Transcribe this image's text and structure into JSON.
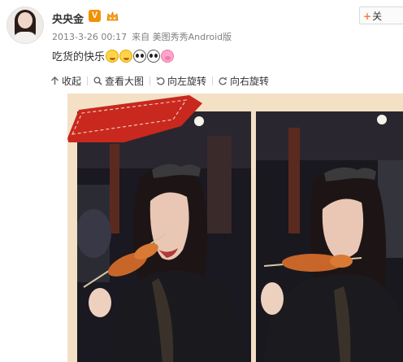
{
  "user": {
    "name": "央央金",
    "verified_badge": "V",
    "avatar_icon": "user-avatar"
  },
  "follow": {
    "label": "关"
  },
  "meta": {
    "time": "2013-3-26 00:17",
    "source": "来自 美图秀秀Android版"
  },
  "post": {
    "text": "吃货的快乐",
    "emojis": [
      "drool-emoji",
      "drool-emoji",
      "panda-emoji",
      "panda-emoji",
      "pig-emoji"
    ]
  },
  "toolbar": {
    "collapse_label": "收起",
    "view_large_label": "查看大图",
    "rotate_left_label": "向左旋转",
    "rotate_right_label": "向右旋转"
  },
  "colors": {
    "badge": "#f29100",
    "ribbon": "#c8281e",
    "frame": "#f3e0c5"
  }
}
